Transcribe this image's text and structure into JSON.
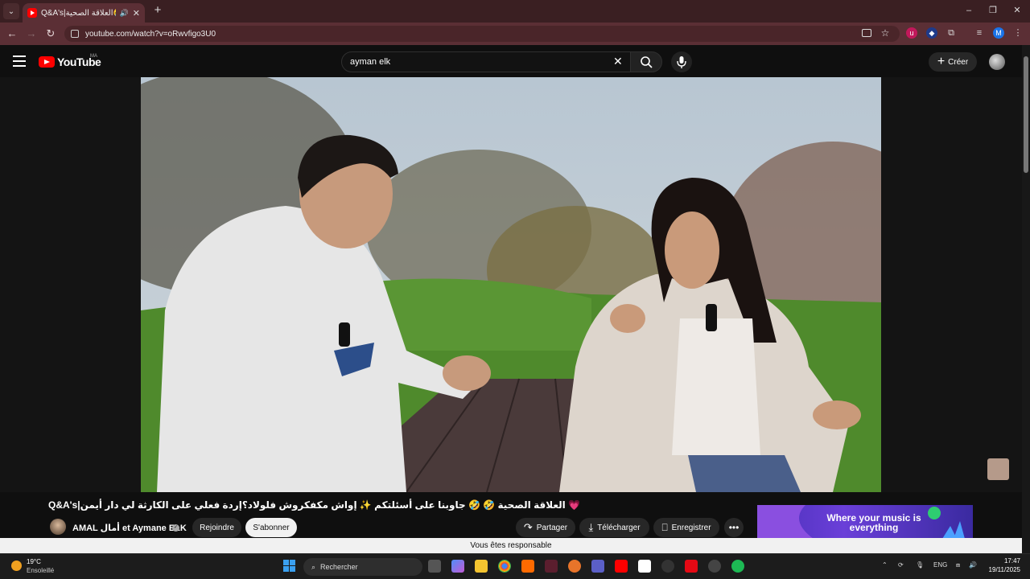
{
  "browser": {
    "tab_title": "Q&A's|العلاقة الصحية🤣🤣",
    "new_tab": "+",
    "url": "youtube.com/watch?v=oRwvfigo3U0",
    "window_controls": [
      "–",
      "❐",
      "✕"
    ]
  },
  "youtube": {
    "logo_text": "YouTube",
    "country": "MA",
    "search_value": "ayman elk",
    "create_label": "Créer"
  },
  "video": {
    "title": "Q&A's|العلاقة الصحية 🤣 🤣 جاوبنا على أسئلتكم ✨ إواش مكفكروش فلولاد؟إردة فعلي على الكارثة لي دار أيمن 💗",
    "channel": "AMAL أمال et Aymane ELK",
    "join_label": "Rejoindre",
    "subscribe_label": "S'abonner",
    "share_label": "Partager",
    "download_label": "Télécharger",
    "save_label": "Enregistrer",
    "more_label": "•••"
  },
  "ad": {
    "text": "Where your music is everything"
  },
  "banner": {
    "text": "Vous êtes responsable"
  },
  "taskbar": {
    "weather_temp": "19°C",
    "weather_desc": "Ensoleillé",
    "search_label": "Rechercher",
    "language": "ENG",
    "time": "17:47",
    "date": "19/11/2025"
  },
  "colors": {
    "tab_bar": "#3a1f22",
    "address_bar": "#5b2f35",
    "youtube_red": "#ff0000",
    "yt_bg": "#0f0f0f"
  }
}
